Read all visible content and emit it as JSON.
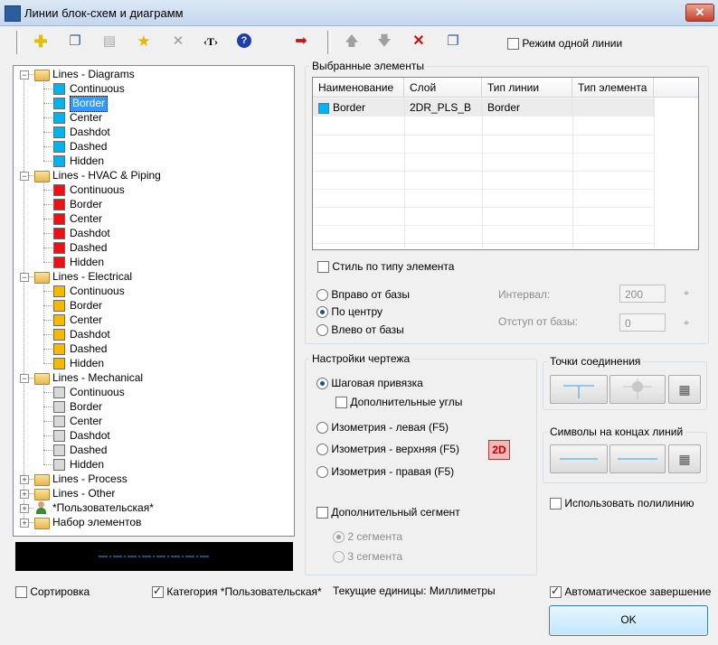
{
  "window": {
    "title": "Линии блок-схем и диаграмм",
    "close_label": "✕"
  },
  "toolbar": {
    "left_icons": [
      "add-icon",
      "copy-icon",
      "properties-icon",
      "star-icon",
      "delete-x-icon",
      "text-icon",
      "help-icon"
    ],
    "text_icon_label": "‹T›",
    "help_icon_label": "?",
    "single_line_mode": "Режим одной линии"
  },
  "tree": {
    "groups": [
      {
        "label": "Lines - Diagrams",
        "color": "#00b4f0",
        "expanded": true,
        "items": [
          "Continuous",
          "Border",
          "Center",
          "Dashdot",
          "Dashed",
          "Hidden"
        ]
      },
      {
        "label": "Lines - HVAC & Piping",
        "color": "#ee1111",
        "expanded": true,
        "items": [
          "Continuous",
          "Border",
          "Center",
          "Dashdot",
          "Dashed",
          "Hidden"
        ]
      },
      {
        "label": "Lines - Electrical",
        "color": "#f8b800",
        "expanded": true,
        "items": [
          "Continuous",
          "Border",
          "Center",
          "Dashdot",
          "Dashed",
          "Hidden"
        ]
      },
      {
        "label": "Lines - Mechanical",
        "color": "#d8d8d8",
        "expanded": true,
        "items": [
          "Continuous",
          "Border",
          "Center",
          "Dashdot",
          "Dashed",
          "Hidden"
        ]
      },
      {
        "label": "Lines - Process",
        "expanded": false
      },
      {
        "label": "Lines - Other",
        "expanded": false
      },
      {
        "label": "*Пользовательская*",
        "expanded": false
      },
      {
        "label": "Набор элементов",
        "expanded": false
      }
    ],
    "selected": "Border"
  },
  "selected_elements": {
    "title": "Выбранные элементы",
    "columns": [
      "Наименование",
      "Слой",
      "Тип линии",
      "Тип элемента"
    ],
    "rows": [
      {
        "name": "Border",
        "layer": "2DR_PLS_B",
        "linetype": "Border",
        "elementtype": "",
        "color": "#00b4f0"
      }
    ],
    "style_by_type": "Стиль по типу элемента",
    "radio_right": "Вправо от базы",
    "radio_center": "По центру",
    "radio_left": "Влево от базы",
    "interval_label": "Интервал:",
    "interval_value": "200",
    "offset_label": "Отступ от базы:",
    "offset_value": "0"
  },
  "drawing_settings": {
    "title": "Настройки чертежа",
    "step_snap": "Шаговая привязка",
    "extra_angles": "Дополнительные углы",
    "iso_left": "Изометрия - левая (F5)",
    "iso_top": "Изометрия - верхняя (F5)",
    "iso_right": "Изометрия - правая (F5)",
    "mode_badge": "2D",
    "extra_segment": "Дополнительный сегмент",
    "two_segments": "2 сегмента",
    "three_segments": "3 сегмента"
  },
  "connection_points": {
    "title": "Точки соединения"
  },
  "line_end_symbols": {
    "title": "Символы на концах линий"
  },
  "use_polyline": "Использовать полилинию",
  "sort": "Сортировка",
  "category_user": "Категория *Пользовательская*",
  "units": "Текущие единицы: Миллиметры",
  "auto_complete": "Автоматическое завершение",
  "ok": "OK"
}
